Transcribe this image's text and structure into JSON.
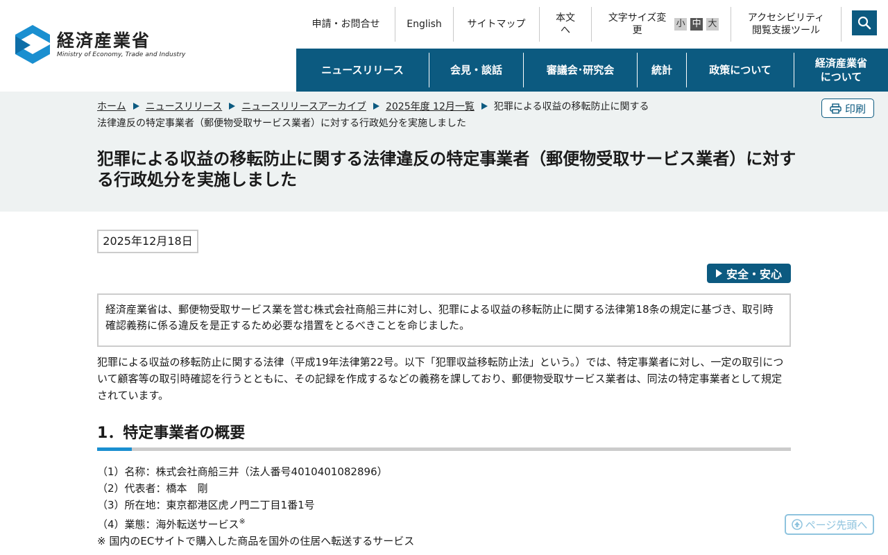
{
  "header": {
    "logo_ja": "経済産業省",
    "logo_en": "Ministry of Economy, Trade and Industry",
    "util": {
      "contact": "申請・お問合せ",
      "english": "English",
      "sitemap": "サイトマップ",
      "main_text": "本文へ",
      "font_size_label": "文字サイズ変更",
      "font_small": "小",
      "font_medium": "中",
      "font_large": "大",
      "accessibility_line1": "アクセシビリティ",
      "accessibility_line2": "閲覧支援ツール"
    },
    "nav": [
      {
        "label": "ニュースリリース"
      },
      {
        "label": "会見・談話"
      },
      {
        "label": "審議会･研究会"
      },
      {
        "label": "統計"
      },
      {
        "label": "政策について"
      },
      {
        "label_line1": "経済産業省",
        "label_line2": "について"
      }
    ]
  },
  "breadcrumb": {
    "items": [
      "ホーム",
      "ニュースリリース",
      "ニュースリリースアーカイブ",
      "2025年度 12月一覧"
    ],
    "current": "犯罪による収益の移転防止に関する法律違反の特定事業者（郵便物受取サービス業者）に対する行政処分を実施しました"
  },
  "print_label": "印刷",
  "page_title": "犯罪による収益の移転防止に関する法律違反の特定事業者（郵便物受取サービス業者）に対する行政処分を実施しました",
  "date": "2025年12月18日",
  "category_tag": "安全・安心",
  "summary": "経済産業省は、郵便物受取サービス業を営む株式会社商船三井に対し、犯罪による収益の移転防止に関する法律第18条の規定に基づき、取引時確認義務に係る違反を是正するため必要な措置をとるべきことを命じました。",
  "body": "犯罪による収益の移転防止に関する法律（平成19年法律第22号。以下「犯罪収益移転防止法」という。）では、特定事業者に対し、一定の取引について顧客等の取引時確認を行うとともに、その記録を作成するなどの義務を課しており、郵便物受取サービス業者は、同法の特定事業者として規定されています。",
  "section1": {
    "heading": "1．特定事業者の概要",
    "items": [
      "（1）名称：株式会社商船三井（法人番号4010401082896）",
      "（2）代表者：橋本　剛",
      "（3）所在地：東京都港区虎ノ門二丁目1番1号",
      "（4）業態：海外転送サービス"
    ],
    "item4_mark": "※",
    "note": "※ 国内のECサイトで購入した商品を国外の住居へ転送するサービス"
  },
  "back_to_top": "ページ先頭へ",
  "colors": {
    "brand": "#0c5a80",
    "accent": "#1b8fd0",
    "band": "#eef2f2"
  }
}
